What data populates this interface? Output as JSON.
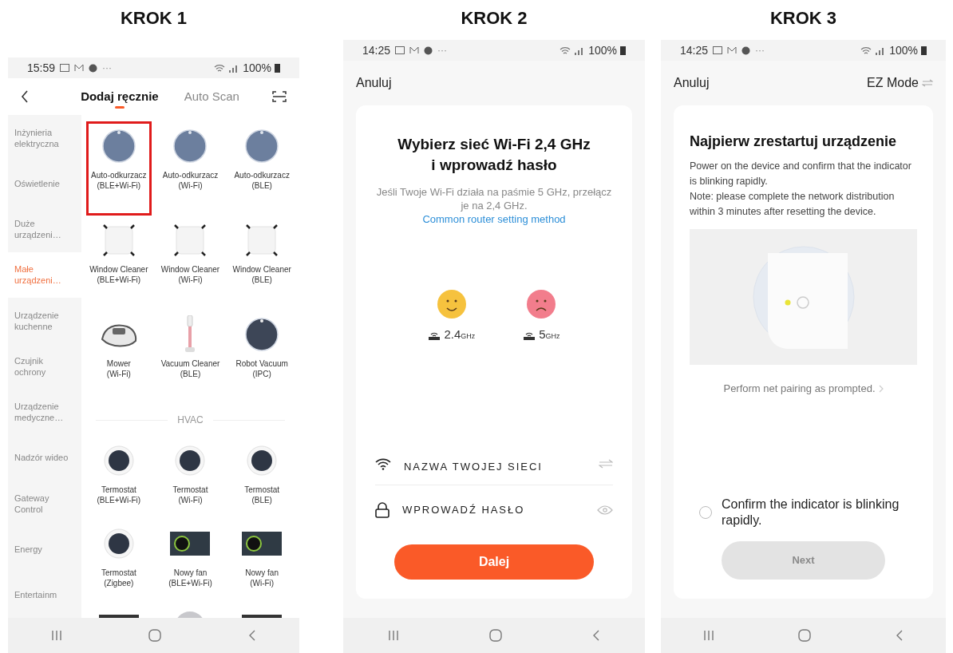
{
  "steps": [
    {
      "heading": "KROK 1",
      "screen": {
        "kind": "device_list",
        "status_bar": {
          "time": "15:59",
          "more": "···",
          "battery": "100%"
        },
        "tabs": [
          {
            "label": "Dodaj ręcznie",
            "selected": true
          },
          {
            "label": "Auto Scan",
            "selected": false
          }
        ],
        "categories": [
          {
            "label": "Inżynieria elektryczna",
            "selected": false
          },
          {
            "label": "Oświetlenie",
            "selected": false
          },
          {
            "label": "Duże urządzeni…",
            "selected": false
          },
          {
            "label": "Małe urządzeni…",
            "selected": true
          },
          {
            "label": "Urządzenie kuchenne",
            "selected": false
          },
          {
            "label": "Czujnik ochrony",
            "selected": false
          },
          {
            "label": "Urządzenie medyczne…",
            "selected": false
          },
          {
            "label": "Nadzór wideo",
            "selected": false
          },
          {
            "label": "Gateway Control",
            "selected": false
          },
          {
            "label": "Energy",
            "selected": false
          },
          {
            "label": "Entertainm",
            "selected": false
          }
        ],
        "sections": [
          {
            "devices": [
              {
                "kind": "robot",
                "name": "Auto-odkurzacz",
                "protocol": "(BLE+Wi-Fi)",
                "highlighted": true
              },
              {
                "kind": "robot",
                "name": "Auto-odkurzacz",
                "protocol": "(Wi-Fi)",
                "highlighted": false
              },
              {
                "kind": "robot",
                "name": "Auto-odkurzacz",
                "protocol": "(BLE)",
                "highlighted": false
              },
              {
                "kind": "window",
                "name": "Window Cleaner",
                "protocol": "(BLE+Wi-Fi)",
                "highlighted": false
              },
              {
                "kind": "window",
                "name": "Window Cleaner",
                "protocol": "(Wi-Fi)",
                "highlighted": false
              },
              {
                "kind": "window",
                "name": "Window Cleaner",
                "protocol": "(BLE)",
                "highlighted": false
              },
              {
                "kind": "mower",
                "name": "Mower",
                "protocol": "(Wi-Fi)",
                "highlighted": false
              },
              {
                "kind": "stick",
                "name": "Vacuum Cleaner",
                "protocol": "(BLE)",
                "highlighted": false
              },
              {
                "kind": "robot_dark",
                "name": "Robot Vacuum",
                "protocol": "(IPC)",
                "highlighted": false
              }
            ]
          },
          {
            "title": "HVAC",
            "devices": [
              {
                "kind": "thermostat",
                "name": "Termostat",
                "protocol": "(BLE+Wi-Fi)",
                "highlighted": false
              },
              {
                "kind": "thermostat",
                "name": "Termostat",
                "protocol": "(Wi-Fi)",
                "highlighted": false
              },
              {
                "kind": "thermostat",
                "name": "Termostat",
                "protocol": "(BLE)",
                "highlighted": false
              },
              {
                "kind": "thermostat",
                "name": "Termostat",
                "protocol": "(Zigbee)",
                "highlighted": false
              },
              {
                "kind": "fan",
                "name": "Nowy fan",
                "protocol": "(BLE+Wi-Fi)",
                "highlighted": false
              },
              {
                "kind": "fan",
                "name": "Nowy fan",
                "protocol": "(Wi-Fi)",
                "highlighted": false
              },
              {
                "kind": "panel_dark",
                "highlighted": false
              },
              {
                "kind": "round_light",
                "highlighted": false
              },
              {
                "kind": "panel_dark",
                "highlighted": false
              }
            ]
          }
        ]
      }
    },
    {
      "heading": "KROK 2",
      "screen": {
        "kind": "wifi_setup",
        "status_bar": {
          "time": "14:25",
          "more": "···",
          "battery": "100%"
        },
        "cancel": "Anuluj",
        "title": "Wybierz sieć Wi-Fi 2,4 GHz i wprowadź hasło",
        "description": "Jeśli Twoje Wi-Fi działa na paśmie 5 GHz, przełącz je na 2,4 GHz.",
        "link": "Common router setting method",
        "bands": [
          {
            "kind": "happy",
            "value": "2.4",
            "unit": "GHz",
            "color": "#f6c23e"
          },
          {
            "kind": "sad",
            "value": "5",
            "unit": "GHz",
            "color": "#f27d8c"
          }
        ],
        "network_field": {
          "placeholder": "NAZWA TWOJEJ SIECI"
        },
        "password_field": {
          "placeholder": "WPROWADŹ HASŁO"
        },
        "button": {
          "label": "Dalej",
          "disabled": false
        }
      }
    },
    {
      "heading": "KROK 3",
      "screen": {
        "kind": "reset_device",
        "status_bar": {
          "time": "14:25",
          "more": "···",
          "battery": "100%"
        },
        "cancel": "Anuluj",
        "mode": "EZ Mode",
        "title": "Najpierw zrestartuj urządzenie",
        "paragraphs": [
          "Power on the device and confirm that the indicator is blinking rapidly.",
          "Note: please complete the network distribution within 3 minutes after resetting the device."
        ],
        "link": "Perform net pairing as prompted.",
        "confirm": {
          "label": "Confirm the indicator is blinking rapidly.",
          "checked": false
        },
        "button": {
          "label": "Next",
          "disabled": true
        }
      }
    }
  ]
}
